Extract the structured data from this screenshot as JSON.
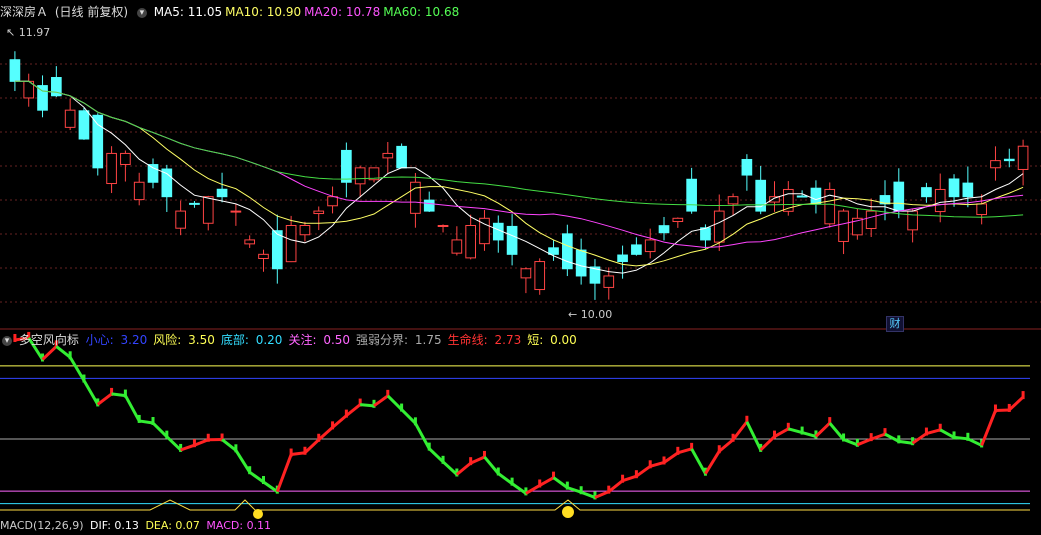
{
  "main_chart": {
    "stock_name": "深深房Ａ",
    "period_mode": "(日线 前复权)",
    "ma_labels": [
      {
        "name": "MA5",
        "value": "11.05",
        "color": "#ffffff"
      },
      {
        "name": "MA10",
        "value": "10.90",
        "color": "#ffff66"
      },
      {
        "name": "MA20",
        "value": "10.78",
        "color": "#ff55ff"
      },
      {
        "name": "MA60",
        "value": "10.68",
        "color": "#55ff55"
      }
    ],
    "high_marker": "11.97",
    "low_marker": "10.00",
    "fin_badge": "财"
  },
  "indicator": {
    "name": "多空风向标",
    "params": [
      {
        "label": "小心",
        "value": "3.20",
        "color": "#3344ff"
      },
      {
        "label": "风险",
        "value": "3.50",
        "color": "#ffff55"
      },
      {
        "label": "底部",
        "value": "0.20",
        "color": "#33ddff"
      },
      {
        "label": "关注",
        "value": "0.50",
        "color": "#ff66ff"
      },
      {
        "label": "强弱分界",
        "value": "1.75",
        "color": "#aaaaaa"
      },
      {
        "label": "生命线",
        "value": "2.73",
        "color": "#ff3333"
      },
      {
        "label": "短",
        "value": "0.00",
        "color": "#ffff55"
      }
    ]
  },
  "macd": {
    "title": "MACD(12,26,9)",
    "dif": "DIF: 0.13",
    "dea": "DEA: 0.07",
    "macd": "MACD: 0.11"
  },
  "colors": {
    "up": "#ff4444",
    "down": "#55ffff",
    "ma5": "#ffffff",
    "ma10": "#ffff66",
    "ma20": "#ff44ff",
    "ma60": "#44dd44",
    "grid": "#662222"
  },
  "chart_data": {
    "type": "candlestick",
    "closes": [
      11.6,
      11.6,
      11.4,
      11.5,
      11.4,
      11.2,
      11.0,
      11.1,
      11.1,
      10.9,
      10.9,
      10.8,
      10.7,
      10.75,
      10.8,
      10.8,
      10.7,
      10.5,
      10.4,
      10.3,
      10.6,
      10.6,
      10.7,
      10.8,
      10.9,
      11.0,
      11.0,
      11.1,
      11.0,
      10.9,
      10.7,
      10.6,
      10.5,
      10.6,
      10.65,
      10.5,
      10.4,
      10.3,
      10.35,
      10.4,
      10.3,
      10.25,
      10.2,
      10.25,
      10.35,
      10.4,
      10.5,
      10.55,
      10.65,
      10.7,
      10.5,
      10.7,
      10.8,
      10.95,
      10.7,
      10.8,
      10.85,
      10.8,
      10.75,
      10.85,
      10.7,
      10.65,
      10.7,
      10.75,
      10.7,
      10.7,
      10.8,
      10.85,
      10.8,
      10.8,
      10.75,
      11.05,
      11.05,
      11.15
    ]
  }
}
